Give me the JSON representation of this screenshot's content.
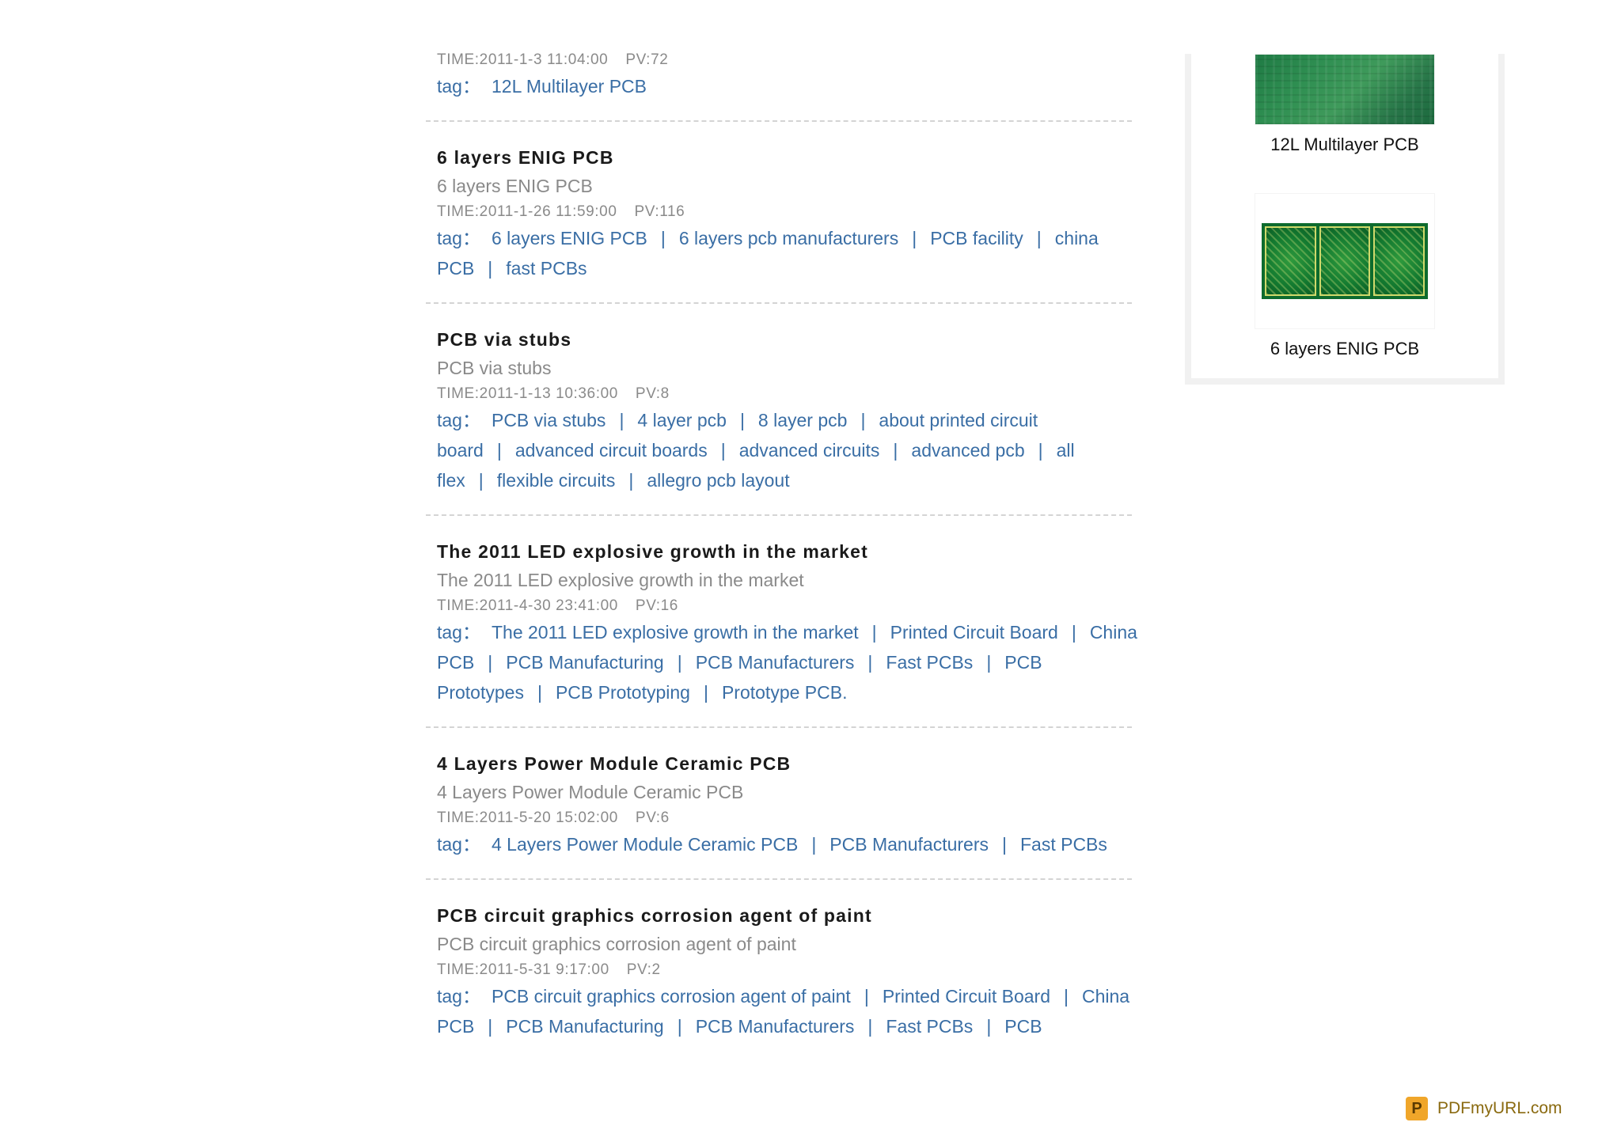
{
  "articles": [
    {
      "title": "",
      "summary": "",
      "time": "TIME:2011-1-3 11:04:00",
      "pv": "PV:72",
      "tag_label": "tag：",
      "tags": [
        "12L Multilayer PCB"
      ]
    },
    {
      "title": "6 layers ENIG PCB",
      "summary": "6 layers ENIG PCB",
      "time": "TIME:2011-1-26 11:59:00",
      "pv": "PV:116",
      "tag_label": "tag：",
      "tags": [
        "6 layers ENIG PCB",
        "6 layers pcb manufacturers",
        "PCB facility",
        "china PCB",
        "fast PCBs"
      ]
    },
    {
      "title": "PCB via stubs",
      "summary": "PCB via stubs",
      "time": "TIME:2011-1-13 10:36:00",
      "pv": "PV:8",
      "tag_label": "tag：",
      "tags": [
        "PCB via stubs",
        "4 layer pcb",
        "8 layer pcb",
        "about printed circuit board",
        "advanced circuit boards",
        "advanced circuits",
        "advanced pcb",
        "all flex",
        "flexible circuits",
        "allegro pcb layout"
      ]
    },
    {
      "title": "The 2011 LED explosive growth in the market",
      "summary": "The 2011 LED explosive growth in the market",
      "time": "TIME:2011-4-30 23:41:00",
      "pv": "PV:16",
      "tag_label": "tag：",
      "tags": [
        "The 2011 LED explosive growth in the market",
        "Printed Circuit Board",
        "China PCB",
        "PCB Manufacturing",
        "PCB Manufacturers",
        "Fast PCBs",
        "PCB Prototypes",
        "PCB Prototyping",
        "Prototype PCB."
      ]
    },
    {
      "title": "4 Layers Power Module Ceramic PCB",
      "summary": "4 Layers Power Module Ceramic PCB",
      "time": "TIME:2011-5-20 15:02:00",
      "pv": "PV:6",
      "tag_label": "tag：",
      "tags": [
        "4 Layers Power Module Ceramic PCB",
        "PCB Manufacturers",
        "Fast PCBs"
      ]
    },
    {
      "title": "PCB circuit graphics corrosion agent of paint",
      "summary": "PCB circuit graphics corrosion agent of paint",
      "time": "TIME:2011-5-31 9:17:00",
      "pv": "PV:2",
      "tag_label": "tag：",
      "tags": [
        "PCB circuit graphics corrosion agent of paint",
        "Printed Circuit Board",
        "China PCB",
        "PCB Manufacturing",
        "PCB Manufacturers",
        "Fast PCBs",
        "PCB"
      ]
    }
  ],
  "sidebar": {
    "items": [
      {
        "caption": "12L Multilayer PCB"
      },
      {
        "caption": "6 layers ENIG PCB"
      }
    ]
  },
  "footer": {
    "brand_icon": "P",
    "brand_text": "PDFmyURL.com"
  },
  "colors": {
    "link": "#3a6ea5",
    "muted": "#8a8a8a",
    "title": "#1a1a1a"
  }
}
